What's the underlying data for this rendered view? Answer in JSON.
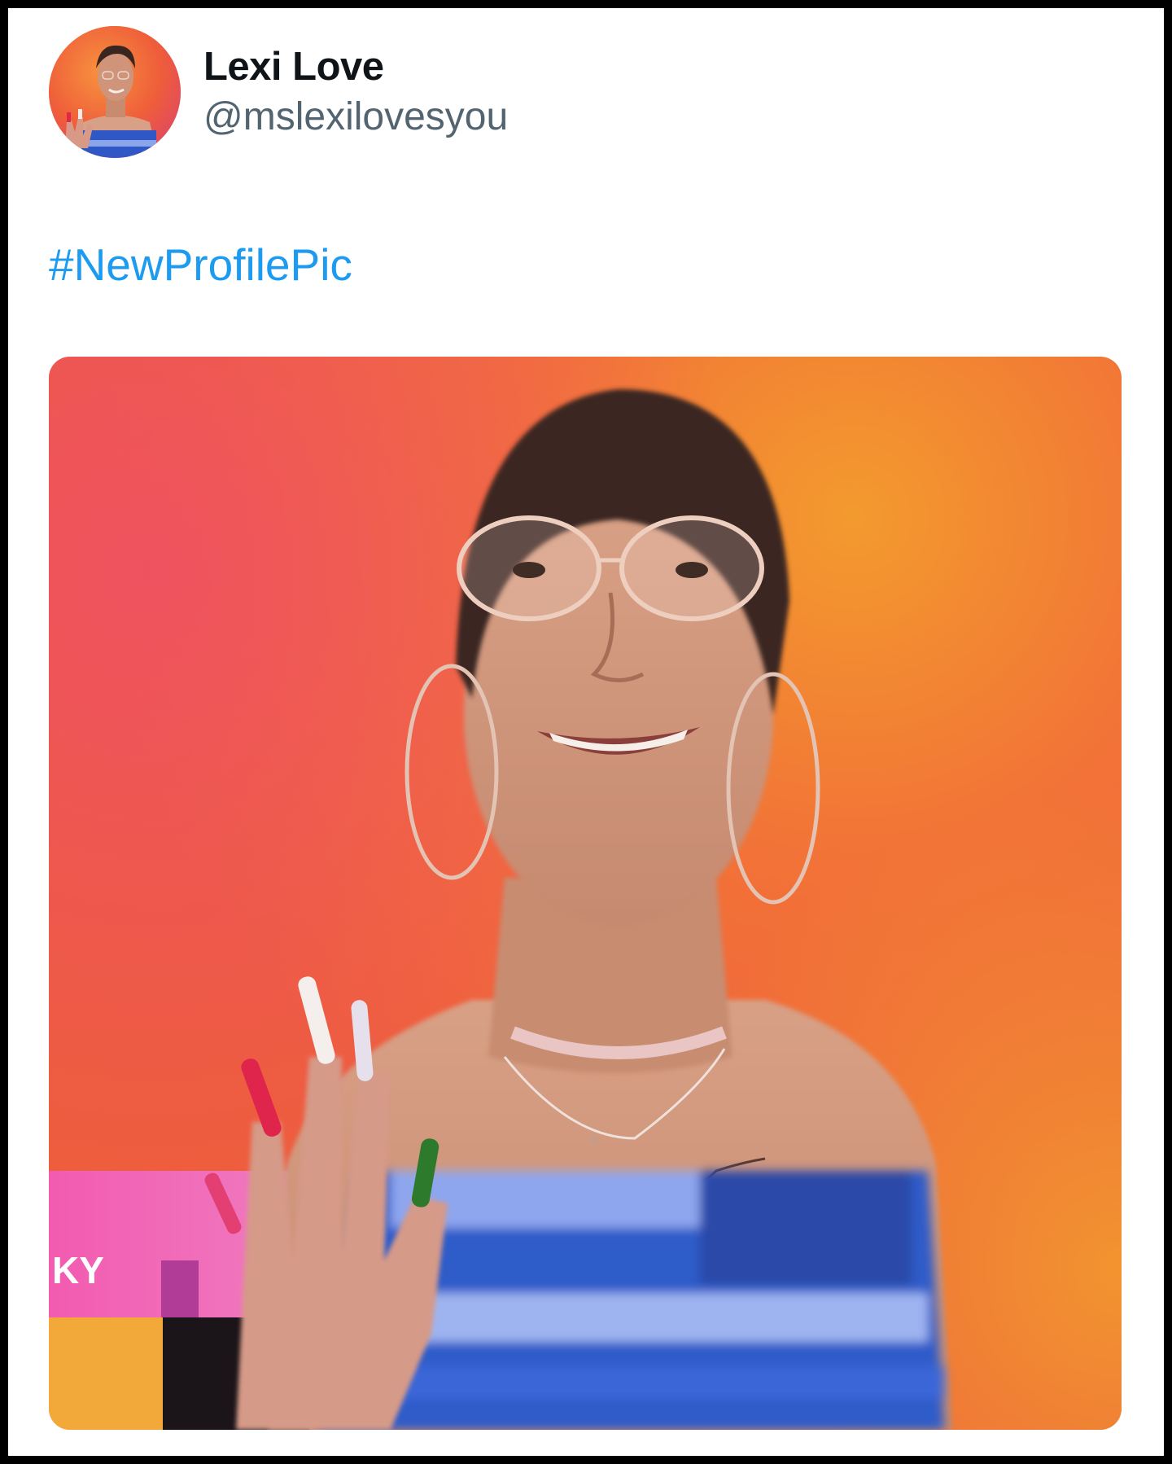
{
  "tweet": {
    "author": {
      "display_name": "Lexi Love",
      "handle": "@mslexilovesyou",
      "avatar_icon": "profile-photo"
    },
    "text": {
      "hashtag": "#NewProfilePic"
    },
    "media": {
      "description_icon": "photo"
    }
  },
  "colors": {
    "hashtag": "#1d9bf0",
    "handle": "#536471",
    "name": "#0f1419",
    "background": "#ffffff",
    "border": "#000000"
  }
}
